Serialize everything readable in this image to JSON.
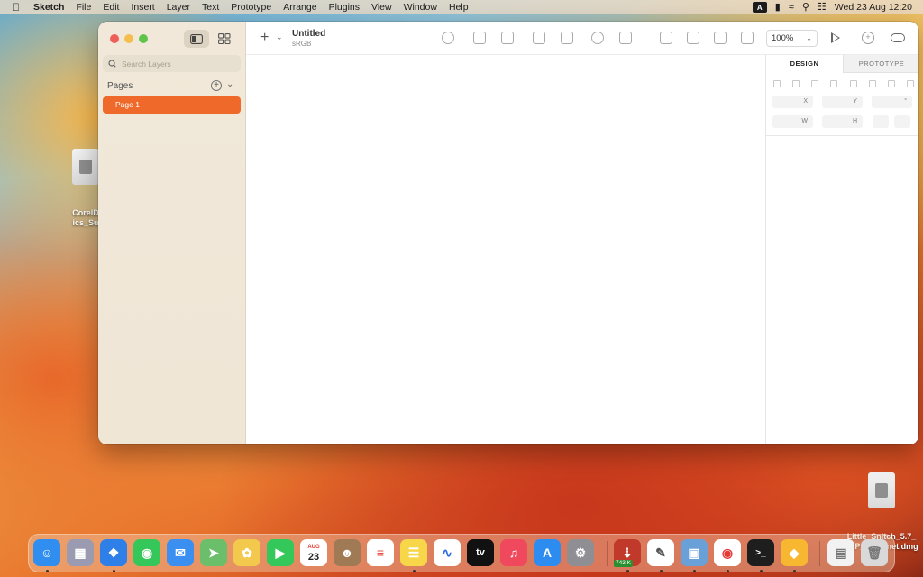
{
  "menubar": {
    "app_name": "Sketch",
    "items": [
      "File",
      "Edit",
      "Insert",
      "Layer",
      "Text",
      "Prototype",
      "Arrange",
      "Plugins",
      "View",
      "Window",
      "Help"
    ],
    "input_badge": "A",
    "clock": "Wed 23 Aug  12:20"
  },
  "desktop": {
    "file_left_label": "CorelD\nics_Su",
    "file_right_label": "Little_Snitch_5.7_\n_EP_Torr...net.dmg"
  },
  "sidebar": {
    "search_placeholder": "Search Layers",
    "pages_label": "Pages",
    "pages": [
      {
        "label": "Page 1",
        "selected": true
      }
    ]
  },
  "toolbar": {
    "document_title": "Untitled",
    "color_profile": "sRGB",
    "zoom": "100%"
  },
  "inspector": {
    "tabs": [
      "DESIGN",
      "PROTOTYPE"
    ],
    "active_tab": "DESIGN",
    "fields": {
      "x": "X",
      "y": "Y",
      "rotation": "°",
      "w": "W",
      "h": "H"
    }
  },
  "dock": {
    "calendar_month": "AUG",
    "calendar_day": "23",
    "download_badge": "743 K",
    "tv_label": "tv",
    "apps": [
      {
        "name": "Finder",
        "color": "#2f8ef0"
      },
      {
        "name": "Launchpad",
        "color": "#9a9ab0"
      },
      {
        "name": "Safari",
        "color": "#2f7fe8"
      },
      {
        "name": "Messages",
        "color": "#35c759"
      },
      {
        "name": "Mail",
        "color": "#3a8ff0"
      },
      {
        "name": "Maps",
        "color": "#6bbf6b"
      },
      {
        "name": "Photos",
        "color": "#f2c94c"
      },
      {
        "name": "FaceTime",
        "color": "#34c759"
      },
      {
        "name": "Calendar",
        "color": "#ffffff"
      },
      {
        "name": "Contacts",
        "color": "#a07a55"
      },
      {
        "name": "Reminders",
        "color": "#ffffff"
      },
      {
        "name": "Notes",
        "color": "#f7d64a"
      },
      {
        "name": "Freeform",
        "color": "#ffffff"
      },
      {
        "name": "TV",
        "color": "#111111"
      },
      {
        "name": "Music",
        "color": "#f0485c"
      },
      {
        "name": "App Store",
        "color": "#2d8cf0"
      },
      {
        "name": "System Settings",
        "color": "#8e8e93"
      },
      {
        "name": "Downloader",
        "color": "#c0392b"
      },
      {
        "name": "TextEdit",
        "color": "#ffffff"
      },
      {
        "name": "Preview",
        "color": "#6aa0d8"
      },
      {
        "name": "Chrome",
        "color": "#ffffff"
      },
      {
        "name": "Terminal",
        "color": "#1e1e1e"
      },
      {
        "name": "Sketch",
        "color": "#f7b731"
      },
      {
        "name": "Document",
        "color": "#f2f2f2"
      },
      {
        "name": "Trash",
        "color": "#d9d9d9"
      }
    ]
  }
}
